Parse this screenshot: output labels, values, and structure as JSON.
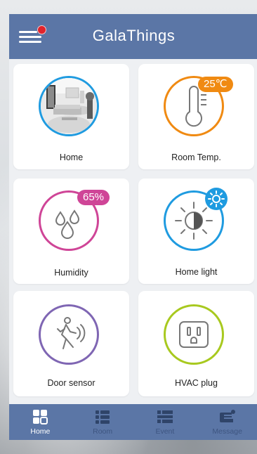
{
  "app": {
    "title": "GalaThings"
  },
  "colors": {
    "appbar": "#5b76a6",
    "blue": "#1f9be0",
    "orange": "#f08a12",
    "magenta": "#cf4597",
    "purple": "#7f66b3",
    "green": "#a8c91f",
    "notification_dot": "#e0232c"
  },
  "cards": [
    {
      "label": "Home",
      "icon": "home-photo"
    },
    {
      "label": "Room Temp.",
      "icon": "thermometer-icon",
      "badge": "25℃"
    },
    {
      "label": "Humidity",
      "icon": "water-drops-icon",
      "badge": "65%"
    },
    {
      "label": "Home light",
      "icon": "light-dimmer-icon",
      "badge_icon": "sun-icon"
    },
    {
      "label": "Door sensor",
      "icon": "walking-person-icon"
    },
    {
      "label": "HVAC plug",
      "icon": "power-outlet-icon"
    }
  ],
  "tabs": [
    {
      "label": "Home",
      "icon": "grid-icon",
      "active": true
    },
    {
      "label": "Room",
      "icon": "list-icon",
      "active": false
    },
    {
      "label": "Event",
      "icon": "event-list-icon",
      "active": false
    },
    {
      "label": "Message",
      "icon": "message-icon",
      "active": false
    }
  ]
}
